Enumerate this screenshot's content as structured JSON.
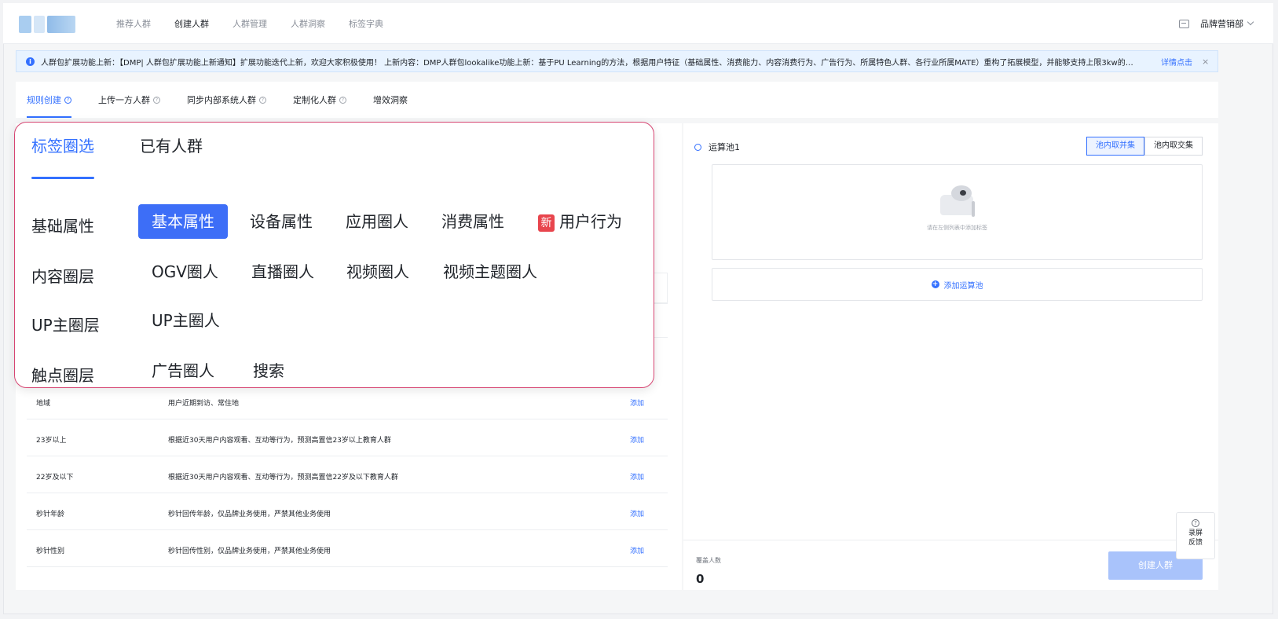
{
  "nav": {
    "items": [
      {
        "label": "推荐人群",
        "active": false
      },
      {
        "label": "创建人群",
        "active": true
      },
      {
        "label": "人群管理",
        "active": false
      },
      {
        "label": "人群洞察",
        "active": false
      },
      {
        "label": "标签字典",
        "active": false
      }
    ],
    "user": "品牌营销部"
  },
  "notice": {
    "text": "人群包扩展功能上新：【DMP| 人群包扩展功能上新通知】扩展功能迭代上新，欢迎大家积极使用！ 上新内容：DMP人群包lookalike功能上新：基于PU Learning的方法，根据用户特征（基础属性、消费能力、内容消费行为、广告行为、所属特色人群、各行业所属MATE）重构了拓展模型，并能够支持上限3kw的…",
    "link": "详情点击",
    "close": "×"
  },
  "subtabs": [
    {
      "label": "规则创建",
      "help": true,
      "active": true
    },
    {
      "label": "上传一方人群",
      "help": true,
      "active": false
    },
    {
      "label": "同步内部系统人群",
      "help": true,
      "active": false
    },
    {
      "label": "定制化人群",
      "help": true,
      "active": false
    },
    {
      "label": "增效洞察",
      "help": false,
      "active": false
    }
  ],
  "popup": {
    "tabs": [
      {
        "label": "标签圈选",
        "active": true
      },
      {
        "label": "已有人群",
        "active": false
      }
    ],
    "rows": {
      "r1": {
        "label": "基础属性",
        "items": [
          "基本属性",
          "设备属性",
          "应用圈人",
          "消费属性"
        ],
        "badge": "新",
        "badge_item": "用户行为"
      },
      "r2": {
        "label": "内容圈层",
        "items": [
          "OGV圈人",
          "直播圈人",
          "视频圈人",
          "视频主题圈人"
        ]
      },
      "r3": {
        "label": "UP主圈层",
        "items": [
          "UP主圈人"
        ]
      },
      "r4": {
        "label": "触点圈层",
        "items": [
          "广告圈人",
          "搜索"
        ]
      }
    }
  },
  "table": {
    "rows": [
      {
        "name": "地域",
        "desc": "用户近期到访、常住地",
        "action": "添加"
      },
      {
        "name": "23岁以上",
        "desc": "根据近30天用户内容观看、互动等行为，预测高置信23岁以上教育人群",
        "action": "添加"
      },
      {
        "name": "22岁及以下",
        "desc": "根据近30天用户内容观看、互动等行为，预测高置信22岁及以下教育人群",
        "action": "添加"
      },
      {
        "name": "秒针年龄",
        "desc": "秒针回传年龄，仅品牌业务使用，严禁其他业务使用",
        "action": "添加"
      },
      {
        "name": "秒针性别",
        "desc": "秒针回传性别，仅品牌业务使用，严禁其他业务使用",
        "action": "添加"
      }
    ]
  },
  "right": {
    "pool_title": "运算池1",
    "seg": [
      "池内取并集",
      "池内取交集"
    ],
    "drop_hint": "请在左侧列表中添加标签",
    "add_pool": "添加运算池",
    "cover_label": "覆盖人数",
    "cover_value": "0",
    "create_button": "创建人群"
  },
  "feedback": {
    "line1": "录屏",
    "line2": "反馈"
  },
  "colors": {
    "accent": "#3370ff",
    "popup_border": "#d64572",
    "badge": "#e8454d"
  }
}
